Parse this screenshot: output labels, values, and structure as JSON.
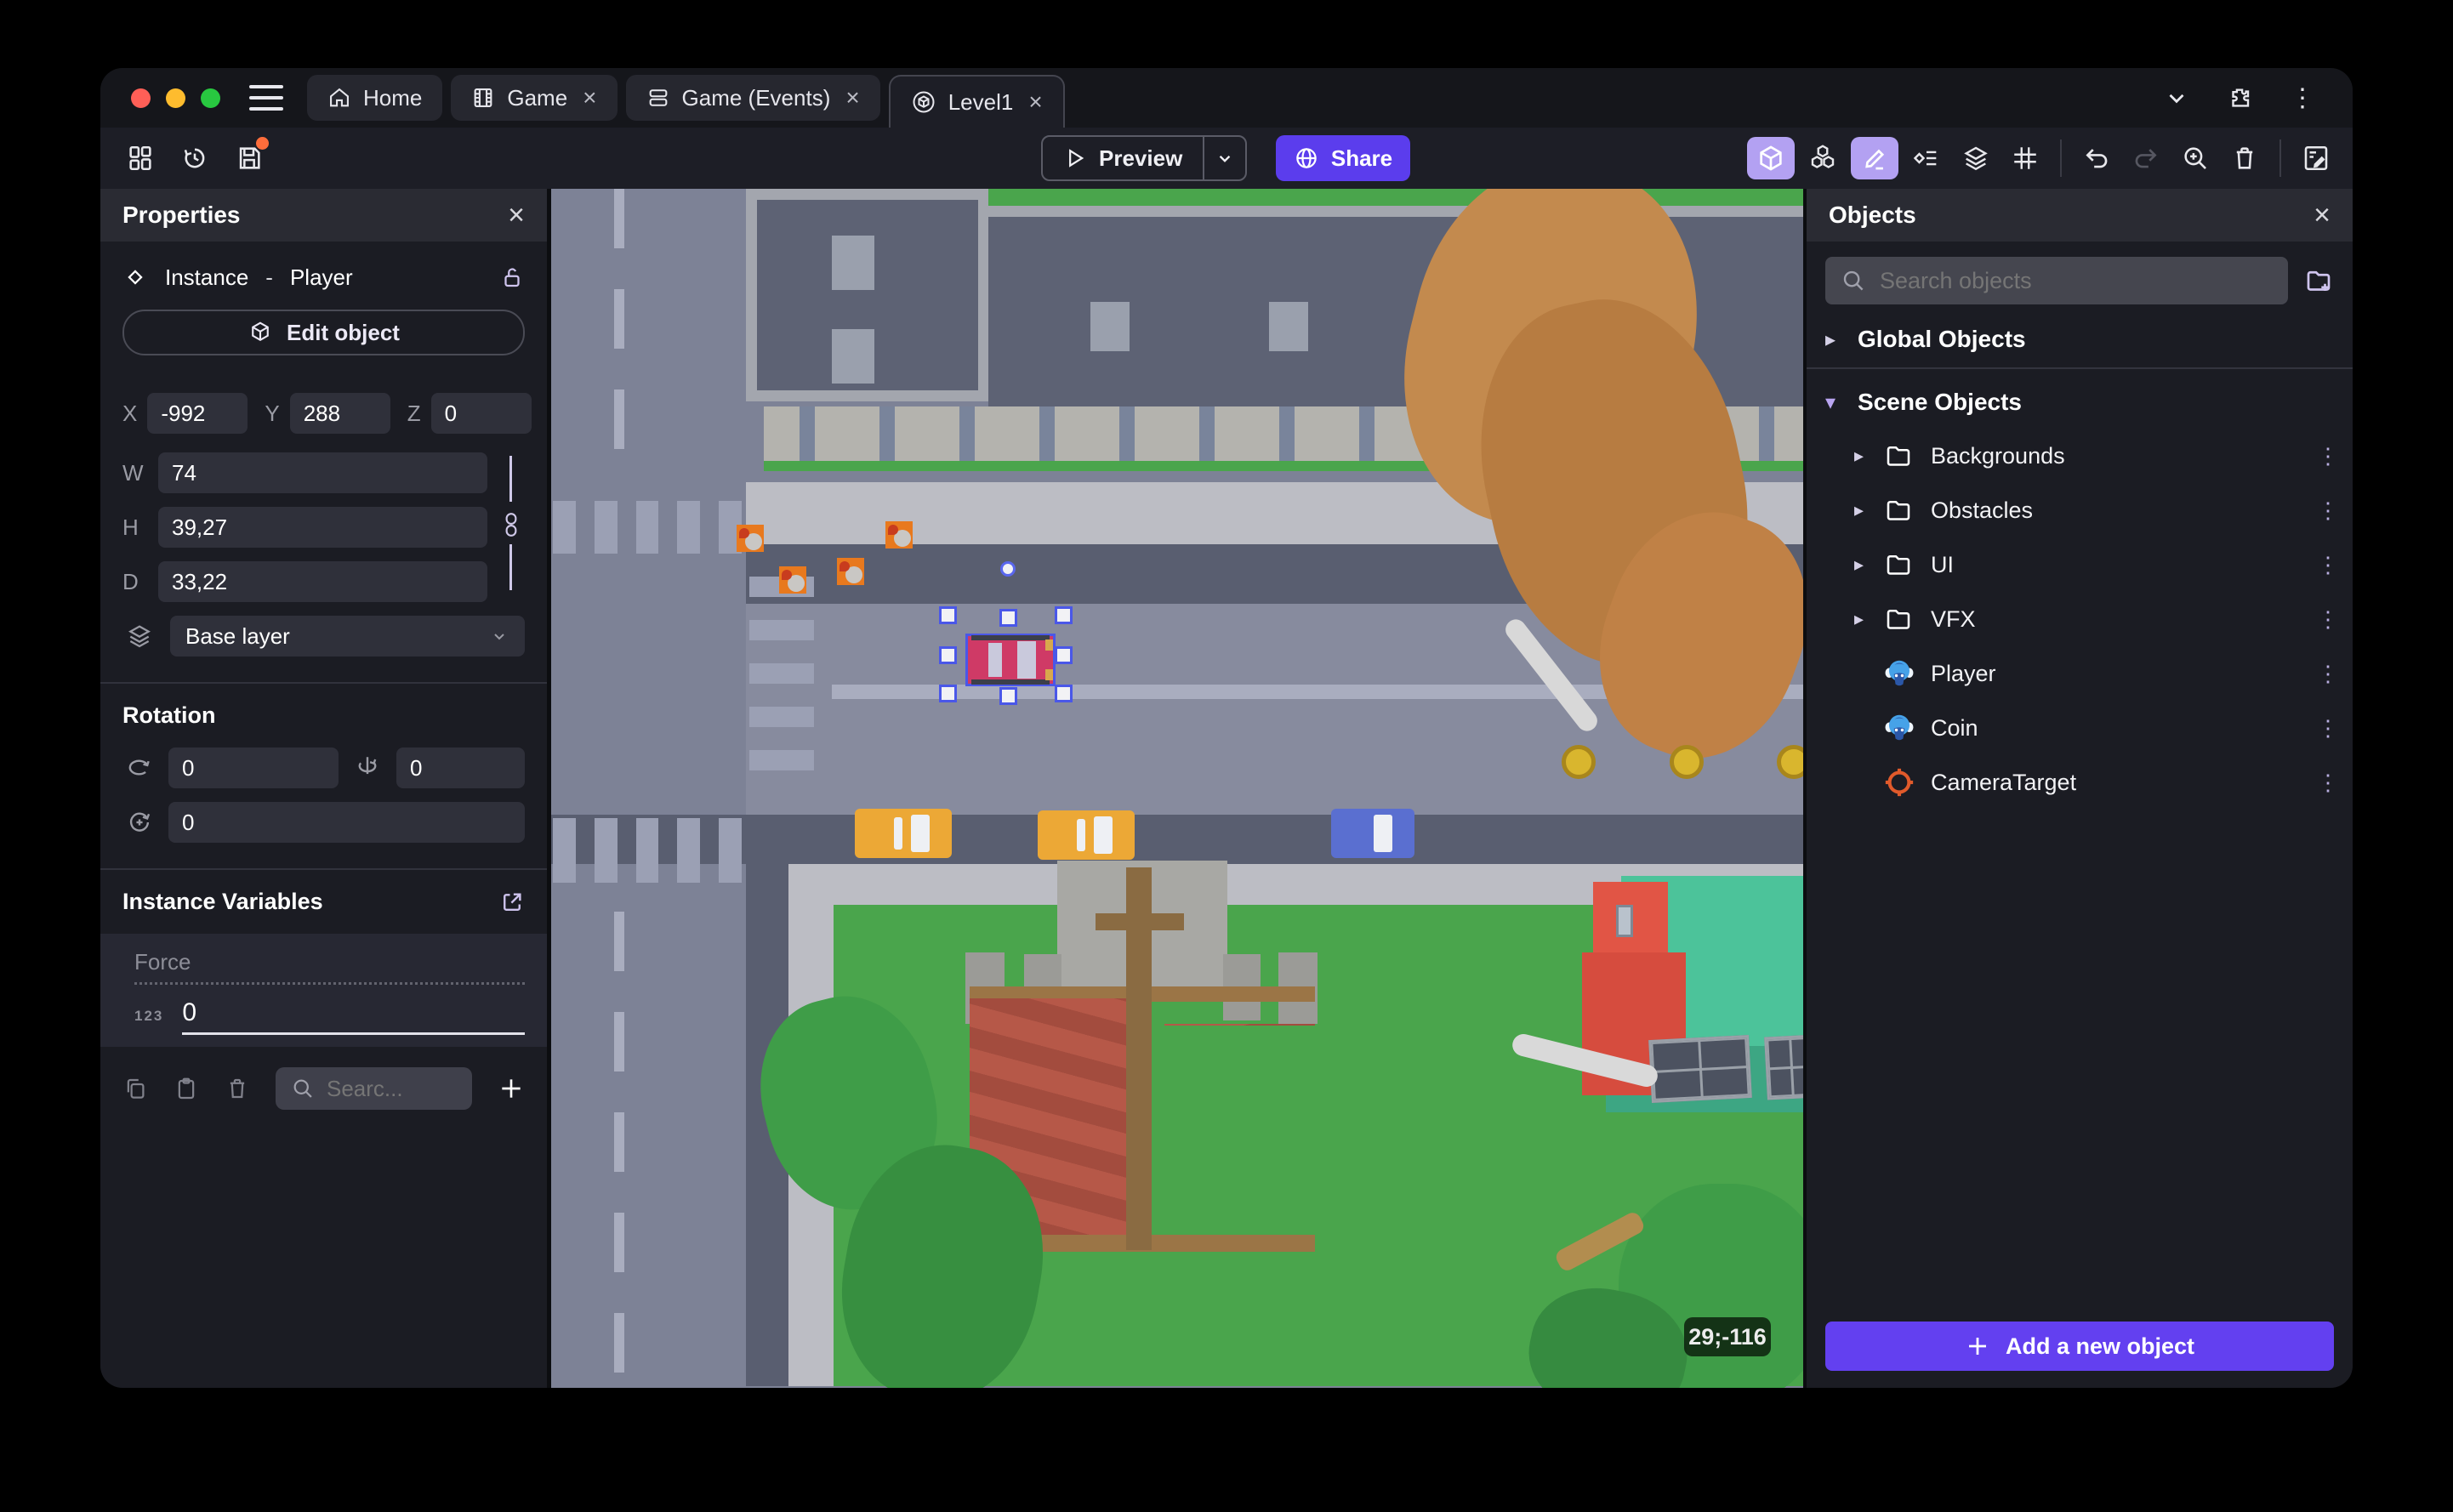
{
  "tabs": {
    "items": [
      {
        "label": "Home",
        "closable": false,
        "active": false
      },
      {
        "label": "Game",
        "closable": true,
        "active": false
      },
      {
        "label": "Game (Events)",
        "closable": true,
        "active": false
      },
      {
        "label": "Level1",
        "closable": true,
        "active": true
      }
    ]
  },
  "toolbar": {
    "preview_label": "Preview",
    "share_label": "Share"
  },
  "properties": {
    "title": "Properties",
    "instance_type": "Instance",
    "separator": "-",
    "object_name": "Player",
    "edit_object_label": "Edit object",
    "coords": {
      "x_label": "X",
      "x": "-992",
      "y_label": "Y",
      "y": "288",
      "z_label": "Z",
      "z": "0"
    },
    "size": {
      "w_label": "W",
      "w": "74",
      "h_label": "H",
      "h": "39,27",
      "d_label": "D",
      "d": "33,22"
    },
    "layer": "Base layer",
    "rotation": {
      "title": "Rotation",
      "x": "0",
      "y": "0",
      "z": "0"
    },
    "variables": {
      "title": "Instance Variables",
      "name": "Force",
      "type_badge": "123",
      "value": "0",
      "search_placeholder": "Searc..."
    }
  },
  "objects": {
    "title": "Objects",
    "search_placeholder": "Search objects",
    "global_group": "Global Objects",
    "scene_group": "Scene Objects",
    "items": [
      {
        "label": "Backgrounds",
        "kind": "folder"
      },
      {
        "label": "Obstacles",
        "kind": "folder"
      },
      {
        "label": "UI",
        "kind": "folder"
      },
      {
        "label": "VFX",
        "kind": "folder"
      },
      {
        "label": "Player",
        "kind": "object"
      },
      {
        "label": "Coin",
        "kind": "object"
      },
      {
        "label": "CameraTarget",
        "kind": "camera"
      }
    ],
    "add_button_label": "Add a new object"
  },
  "canvas": {
    "coordinate_badge": "29;-116"
  },
  "glyphs": {
    "close": "×",
    "kebab": "⋮",
    "caret_right": "▸",
    "caret_down": "▾"
  },
  "colors": {
    "accent_purple": "#5b3ded",
    "add_button_purple": "#6340f0",
    "selection_blue": "#4a57e8",
    "active_tool_bg": "#b3a1f2",
    "save_badge_orange": "#ff6d3b",
    "traffic_red": "#ff5f57",
    "traffic_yellow": "#febc2e",
    "traffic_green": "#28c840",
    "grass_green": "#4aa54c",
    "road_gray": "#7d8296",
    "dark_road": "#595e70",
    "sidewalk": "#bcbdc4",
    "selected_car_pink": "#cf3a66",
    "camera_target_orange": "#e05a2b"
  }
}
